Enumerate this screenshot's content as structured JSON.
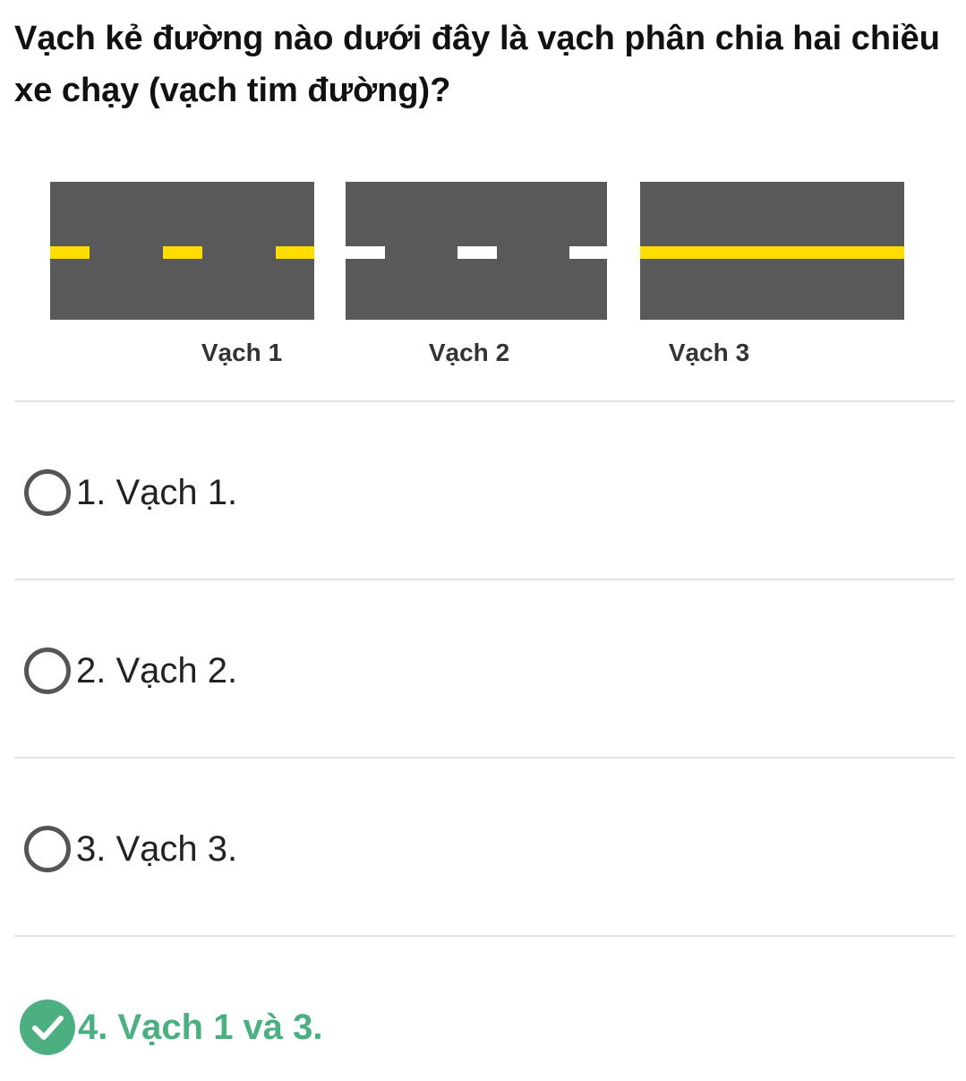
{
  "question": "Vạch kẻ đường nào dưới đây là vạch phân chia hai chiều xe chạy (vạch tim đường)?",
  "figure": {
    "labels": [
      "Vạch 1",
      "Vạch 2",
      "Vạch 3"
    ],
    "colors": {
      "asphalt": "#595959",
      "yellow": "#ffdd00",
      "white": "#ffffff"
    }
  },
  "options": [
    {
      "text": "1. Vạch 1.",
      "state": "unselected"
    },
    {
      "text": "2. Vạch 2.",
      "state": "unselected"
    },
    {
      "text": "3. Vạch 3.",
      "state": "unselected"
    },
    {
      "text": "4. Vạch 1 và 3.",
      "state": "correct"
    }
  ],
  "colors": {
    "correct": "#4caf82",
    "radio_border": "#555555",
    "divider": "#e3e3e3"
  }
}
